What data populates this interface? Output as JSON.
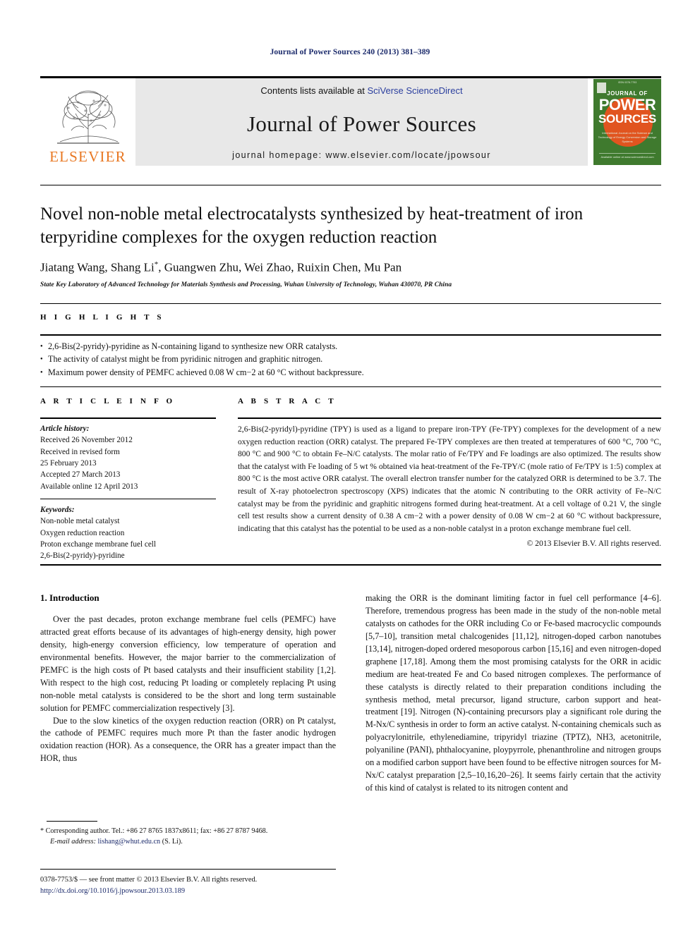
{
  "running_head": "Journal of Power Sources 240 (2013) 381–389",
  "masthead": {
    "publisher_logo_text": "ELSEVIER",
    "contents_prefix": "Contents lists available at ",
    "contents_link": "SciVerse ScienceDirect",
    "journal_name": "Journal of Power Sources",
    "homepage": "journal homepage: www.elsevier.com/locate/jpowsour",
    "cover": {
      "top_text": "ISSN 0378-7753",
      "line1": "JOURNAL OF",
      "line2": "POWER",
      "line3": "SOURCES",
      "subtitle": "International Journal on the Science and Technology of Energy Conversion and Storage Systems",
      "footer": "Available online at www.sciencedirect.com"
    }
  },
  "article": {
    "title": "Novel non-noble metal electrocatalysts synthesized by heat-treatment of iron terpyridine complexes for the oxygen reduction reaction",
    "authors_pre": "Jiatang Wang, Shang Li",
    "author_marker": "*",
    "authors_post": ", Guangwen Zhu, Wei Zhao, Ruixin Chen, Mu Pan",
    "affiliation": "State Key Laboratory of Advanced Technology for Materials Synthesis and Processing, Wuhan University of Technology, Wuhan 430070, PR China"
  },
  "highlights": {
    "heading": "H I G H L I G H T S",
    "items": [
      "2,6-Bis(2-pyridy)-pyridine as N-containing ligand to synthesize new ORR catalysts.",
      "The activity of catalyst might be from pyridinic nitrogen and graphitic nitrogen.",
      "Maximum power density of PEMFC achieved 0.08 W cm−2 at 60 °C without backpressure."
    ]
  },
  "article_info": {
    "heading": "A R T I C L E   I N F O",
    "history_label": "Article history:",
    "history": [
      "Received 26 November 2012",
      "Received in revised form",
      "25 February 2013",
      "Accepted 27 March 2013",
      "Available online 12 April 2013"
    ],
    "keywords_label": "Keywords:",
    "keywords": [
      "Non-noble metal catalyst",
      "Oxygen reduction reaction",
      "Proton exchange membrane fuel cell",
      "2,6-Bis(2-pyridy)-pyridine"
    ]
  },
  "abstract": {
    "heading": "A B S T R A C T",
    "text": "2,6-Bis(2-pyridyl)-pyridine (TPY) is used as a ligand to prepare iron-TPY (Fe-TPY) complexes for the development of a new oxygen reduction reaction (ORR) catalyst. The prepared Fe-TPY complexes are then treated at temperatures of 600 °C, 700 °C, 800 °C and 900 °C to obtain Fe–N/C catalysts. The molar ratio of Fe/TPY and Fe loadings are also optimized. The results show that the catalyst with Fe loading of 5 wt % obtained via heat-treatment of the Fe-TPY/C (mole ratio of Fe/TPY is 1:5) complex at 800 °C is the most active ORR catalyst. The overall electron transfer number for the catalyzed ORR is determined to be 3.7. The result of X-ray photoelectron spectroscopy (XPS) indicates that the atomic N contributing to the ORR activity of Fe–N/C catalyst may be from the pyridinic and graphitic nitrogens formed during heat-treatment. At a cell voltage of 0.21 V, the single cell test results show a current density of 0.38 A cm−2 with a power density of 0.08 W cm−2 at 60 °C without backpressure, indicating that this catalyst has the potential to be used as a non-noble catalyst in a proton exchange membrane fuel cell.",
    "copyright": "© 2013 Elsevier B.V. All rights reserved."
  },
  "body": {
    "section_heading": "1.  Introduction",
    "left_paragraphs": [
      "Over the past decades, proton exchange membrane fuel cells (PEMFC) have attracted great efforts because of its advantages of high-energy density, high power density, high-energy conversion efficiency, low temperature of operation and environmental benefits. However, the major barrier to the commercialization of PEMFC is the high costs of Pt based catalysts and their insufficient stability [1,2]. With respect to the high cost, reducing Pt loading or completely replacing Pt using non-noble metal catalysts is considered to be the short and long term sustainable solution for PEMFC commercialization respectively [3].",
      "Due to the slow kinetics of the oxygen reduction reaction (ORR) on Pt catalyst, the cathode of PEMFC requires much more Pt than the faster anodic hydrogen oxidation reaction (HOR). As a consequence, the ORR has a greater impact than the HOR, thus"
    ],
    "right_paragraphs": [
      "making the ORR is the dominant limiting factor in fuel cell performance [4–6]. Therefore, tremendous progress has been made in the study of the non-noble metal catalysts on cathodes for the ORR including Co or Fe-based macrocyclic compounds [5,7–10], transition metal chalcogenides [11,12], nitrogen-doped carbon nanotubes [13,14], nitrogen-doped ordered mesoporous carbon [15,16] and even nitrogen-doped graphene [17,18]. Among them the most promising catalysts for the ORR in acidic medium are heat-treated Fe and Co based nitrogen complexes. The performance of these catalysts is directly related to their preparation conditions including the synthesis method, metal precursor, ligand structure, carbon support and heat-treatment [19]. Nitrogen (N)-containing precursors play a significant role during the M-Nx/C synthesis in order to form an active catalyst. N-containing chemicals such as polyacrylonitrile, ethylenediamine, tripyridyl triazine (TPTZ), NH3, acetonitrile, polyaniline (PANI), phthalocyanine, ploypyrrole, phenanthroline and nitrogen groups on a modified carbon support have been found to be effective nitrogen sources for M-Nx/C catalyst preparation [2,5–10,16,20–26]. It seems fairly certain that the activity of this kind of catalyst is related to its nitrogen content and"
    ]
  },
  "footnote": {
    "line1": "* Corresponding author. Tel.: +86 27 8765 1837x8611; fax: +86 27 8787 9468.",
    "email_label": "E-mail address:",
    "email": "lishang@whut.edu.cn",
    "email_suffix": "(S. Li)."
  },
  "imprint": {
    "line1": "0378-7753/$ — see front matter © 2013 Elsevier B.V. All rights reserved.",
    "doi": "http://dx.doi.org/10.1016/j.jpowsour.2013.03.189"
  },
  "colors": {
    "link_blue": "#2b3f9e",
    "ref_blue": "#1b2a6b",
    "elsevier_orange": "#e87722",
    "cover_green": "#3f7a2e",
    "cover_orange": "#e1541f",
    "band_gray": "#e8e8e8"
  }
}
